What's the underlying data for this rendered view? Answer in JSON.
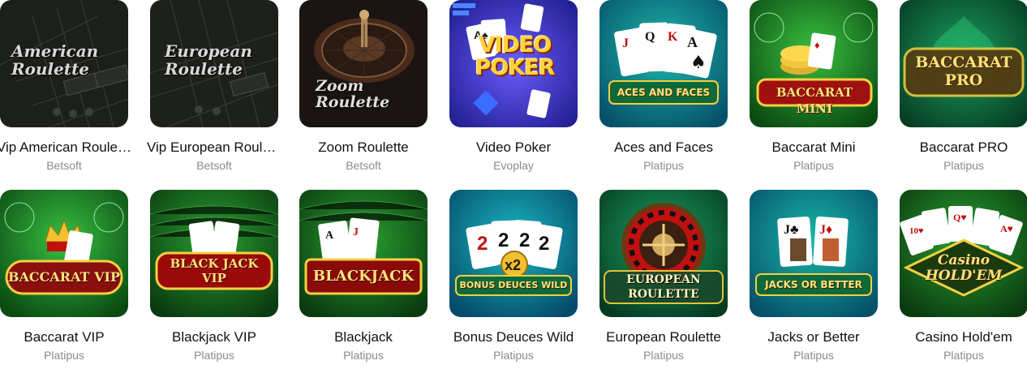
{
  "games": [
    {
      "title": "Vip American Roulette",
      "provider": "Betsoft",
      "logo": "American Roulette",
      "icon": "american-roulette-icon"
    },
    {
      "title": "Vip European Roulette",
      "provider": "Betsoft",
      "logo": "European Roulette",
      "icon": "european-roulette-icon"
    },
    {
      "title": "Zoom Roulette",
      "provider": "Betsoft",
      "logo": "Zoom Roulette",
      "icon": "zoom-roulette-icon"
    },
    {
      "title": "Video Poker",
      "provider": "Evoplay",
      "logo": "VIDEO POKER",
      "icon": "video-poker-icon"
    },
    {
      "title": "Aces and Faces",
      "provider": "Platipus",
      "logo": "ACES AND FACES",
      "icon": "aces-and-faces-icon"
    },
    {
      "title": "Baccarat Mini",
      "provider": "Platipus",
      "logo": "BACCARAT MINI",
      "icon": "baccarat-mini-icon"
    },
    {
      "title": "Baccarat PRO",
      "provider": "Platipus",
      "logo": "BACCARAT PRO",
      "icon": "baccarat-pro-icon"
    },
    {
      "title": "Baccarat VIP",
      "provider": "Platipus",
      "logo": "BACCARAT VIP",
      "icon": "baccarat-vip-icon"
    },
    {
      "title": "Blackjack VIP",
      "provider": "Platipus",
      "logo": "BLACK JACK VIP",
      "icon": "blackjack-vip-icon"
    },
    {
      "title": "Blackjack",
      "provider": "Platipus",
      "logo": "BLACKJACK",
      "icon": "blackjack-icon"
    },
    {
      "title": "Bonus Deuces Wild",
      "provider": "Platipus",
      "logo": "BONUS DEUCES WILD",
      "icon": "bonus-deuces-wild-icon"
    },
    {
      "title": "European Roulette",
      "provider": "Platipus",
      "logo": "EUROPEAN ROULETTE",
      "icon": "european-roulette-wheel-icon"
    },
    {
      "title": "Jacks or Better",
      "provider": "Platipus",
      "logo": "JACKS OR BETTER",
      "icon": "jacks-or-better-icon"
    },
    {
      "title": "Casino Hold'em",
      "provider": "Platipus",
      "logo": "Casino HOLD'EM",
      "icon": "casino-holdem-icon"
    }
  ]
}
